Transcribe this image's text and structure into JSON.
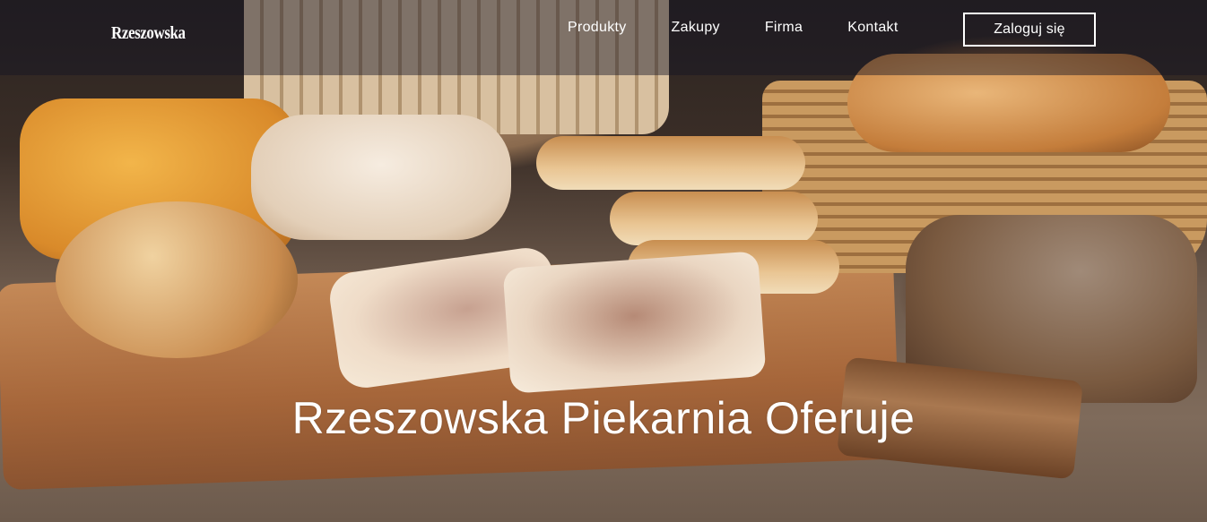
{
  "brand": {
    "logo": "Rzeszowska"
  },
  "nav": {
    "items": [
      {
        "label": "Produkty"
      },
      {
        "label": "Zakupy"
      },
      {
        "label": "Firma"
      },
      {
        "label": "Kontakt"
      }
    ],
    "login_label": "Zaloguj się"
  },
  "hero": {
    "title": "Rzeszowska Piekarnia Oferuje",
    "image": "bakery-breads-photo"
  },
  "colors": {
    "nav_text": "#ffffff",
    "nav_overlay": "#141423",
    "title_text": "#ffffff"
  }
}
